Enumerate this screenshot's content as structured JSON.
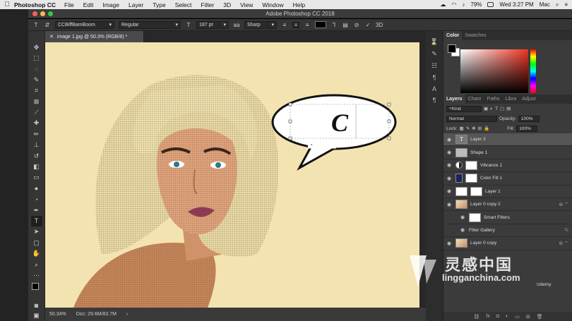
{
  "menubar": {
    "app_name": "Photoshop CC",
    "items": [
      "File",
      "Edit",
      "Image",
      "Layer",
      "Type",
      "Select",
      "Filter",
      "3D",
      "View",
      "Window",
      "Help"
    ],
    "battery": "79%",
    "clock": "Wed 3:27 PM",
    "user": "Mac"
  },
  "window": {
    "title": "Adobe Photoshop CC 2018"
  },
  "options": {
    "font_family": "CCBiffBamBoom",
    "font_style": "Regular",
    "font_size": "187 pt",
    "aa_label": "aa",
    "antialias": "Sharp"
  },
  "document": {
    "tab_title": "image 1.jpg @ 50.3% (RGB/8) *",
    "zoom": "50.34%",
    "doc_info": "Doc: 29.6M/83.7M"
  },
  "bubble": {
    "text": "C"
  },
  "color_panel": {
    "tabs": [
      "Color",
      "Swatches"
    ]
  },
  "layers_panel": {
    "tabs": [
      "Layers",
      "Chanr",
      "Paths",
      "Libra",
      "Adjust"
    ],
    "kind_label": "Kind",
    "blend_mode": "Normal",
    "opacity_label": "Opacity:",
    "opacity": "100%",
    "lock_label": "Lock:",
    "fill_label": "Fill:",
    "fill": "100%",
    "layers": [
      {
        "name": "Layer 2",
        "thumb": "text"
      },
      {
        "name": "Shape 1",
        "thumb": "shape"
      },
      {
        "name": "Vibrance 1",
        "thumb": "adj"
      },
      {
        "name": "Color Fill 1",
        "thumb": "dark"
      },
      {
        "name": "Layer 1",
        "thumb": "white"
      },
      {
        "name": "Layer 0 copy 2",
        "thumb": "photo"
      },
      {
        "name": "Smart Filters",
        "thumb": "white"
      },
      {
        "name": "Filter Gallery",
        "thumb": "none"
      },
      {
        "name": "Layer 0 copy",
        "thumb": "photo"
      }
    ]
  },
  "watermark": {
    "brand": "灵感中国",
    "url": "lingganchina.com",
    "corner": "Udemy"
  },
  "colors": {
    "canvas": "#f3e3b0",
    "panel": "#3b3b3b",
    "accent": "#1a2456"
  }
}
